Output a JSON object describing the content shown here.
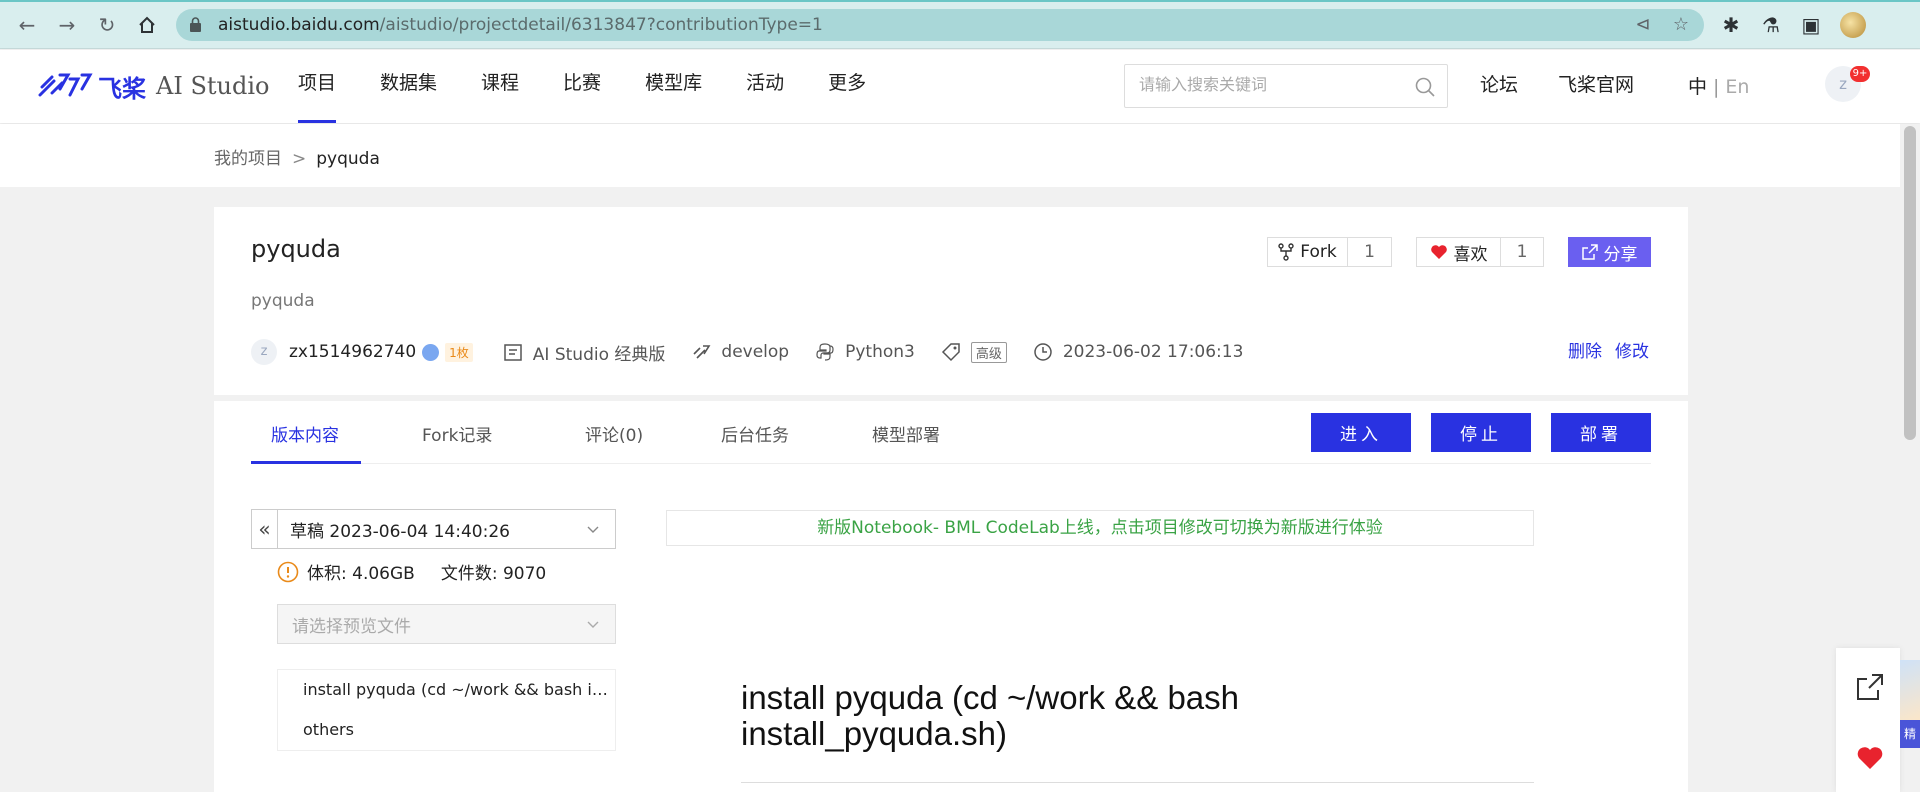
{
  "browser": {
    "url_domain": "aistudio.baidu.com",
    "url_path": "/aistudio/projectdetail/6313847?contributionType=1"
  },
  "header": {
    "logo_mark": "飞桨",
    "logo_en": "AI Studio",
    "nav": [
      "项目",
      "数据集",
      "课程",
      "比赛",
      "模型库",
      "活动",
      "更多"
    ],
    "search_placeholder": "请输入搜索关键词",
    "links": {
      "forum": "论坛",
      "official": "飞桨官网"
    },
    "lang": {
      "zh": "中",
      "sep": "|",
      "en": "En"
    },
    "avatar_letter": "z",
    "notification_count": "9+"
  },
  "breadcrumb": {
    "parent": "我的项目",
    "sep": ">",
    "current": "pyquda"
  },
  "project": {
    "title": "pyquda",
    "description": "pyquda",
    "avatar_letter": "z",
    "username": "zx1514962740",
    "coin_badge": "1枚",
    "edition": "AI Studio 经典版",
    "branch": "develop",
    "language": "Python3",
    "level_tag": "高级",
    "timestamp": "2023-06-02 17:06:13",
    "fork_label": "Fork",
    "fork_count": "1",
    "like_label": "喜欢",
    "like_count": "1",
    "share_label": "分享",
    "delete_label": "删除",
    "edit_label": "修改"
  },
  "tabs": [
    "版本内容",
    "Fork记录",
    "评论(0)",
    "后台任务",
    "模型部署"
  ],
  "actions": {
    "enter": "进入",
    "stop": "停止",
    "deploy": "部署"
  },
  "version": {
    "selected": "草稿 2023-06-04 14:40:26",
    "size_label": "体积: 4.06GB",
    "files_label": "文件数: 9070",
    "preview_placeholder": "请选择预览文件",
    "files": [
      "install pyquda (cd ~/work && bash install_pyquda.sh)",
      "others"
    ]
  },
  "notice": "新版Notebook- BML CodeLab上线，点击项目修改可切换为新版进行体验",
  "markdown": {
    "heading": "install pyquda (cd ~/work && bash install_pyquda.sh)"
  },
  "float": {
    "badge": "精"
  },
  "colors": {
    "brand": "#2932e1",
    "share": "#6a5ff0",
    "notice_green": "#3aa345",
    "like_red": "#e8232e"
  }
}
